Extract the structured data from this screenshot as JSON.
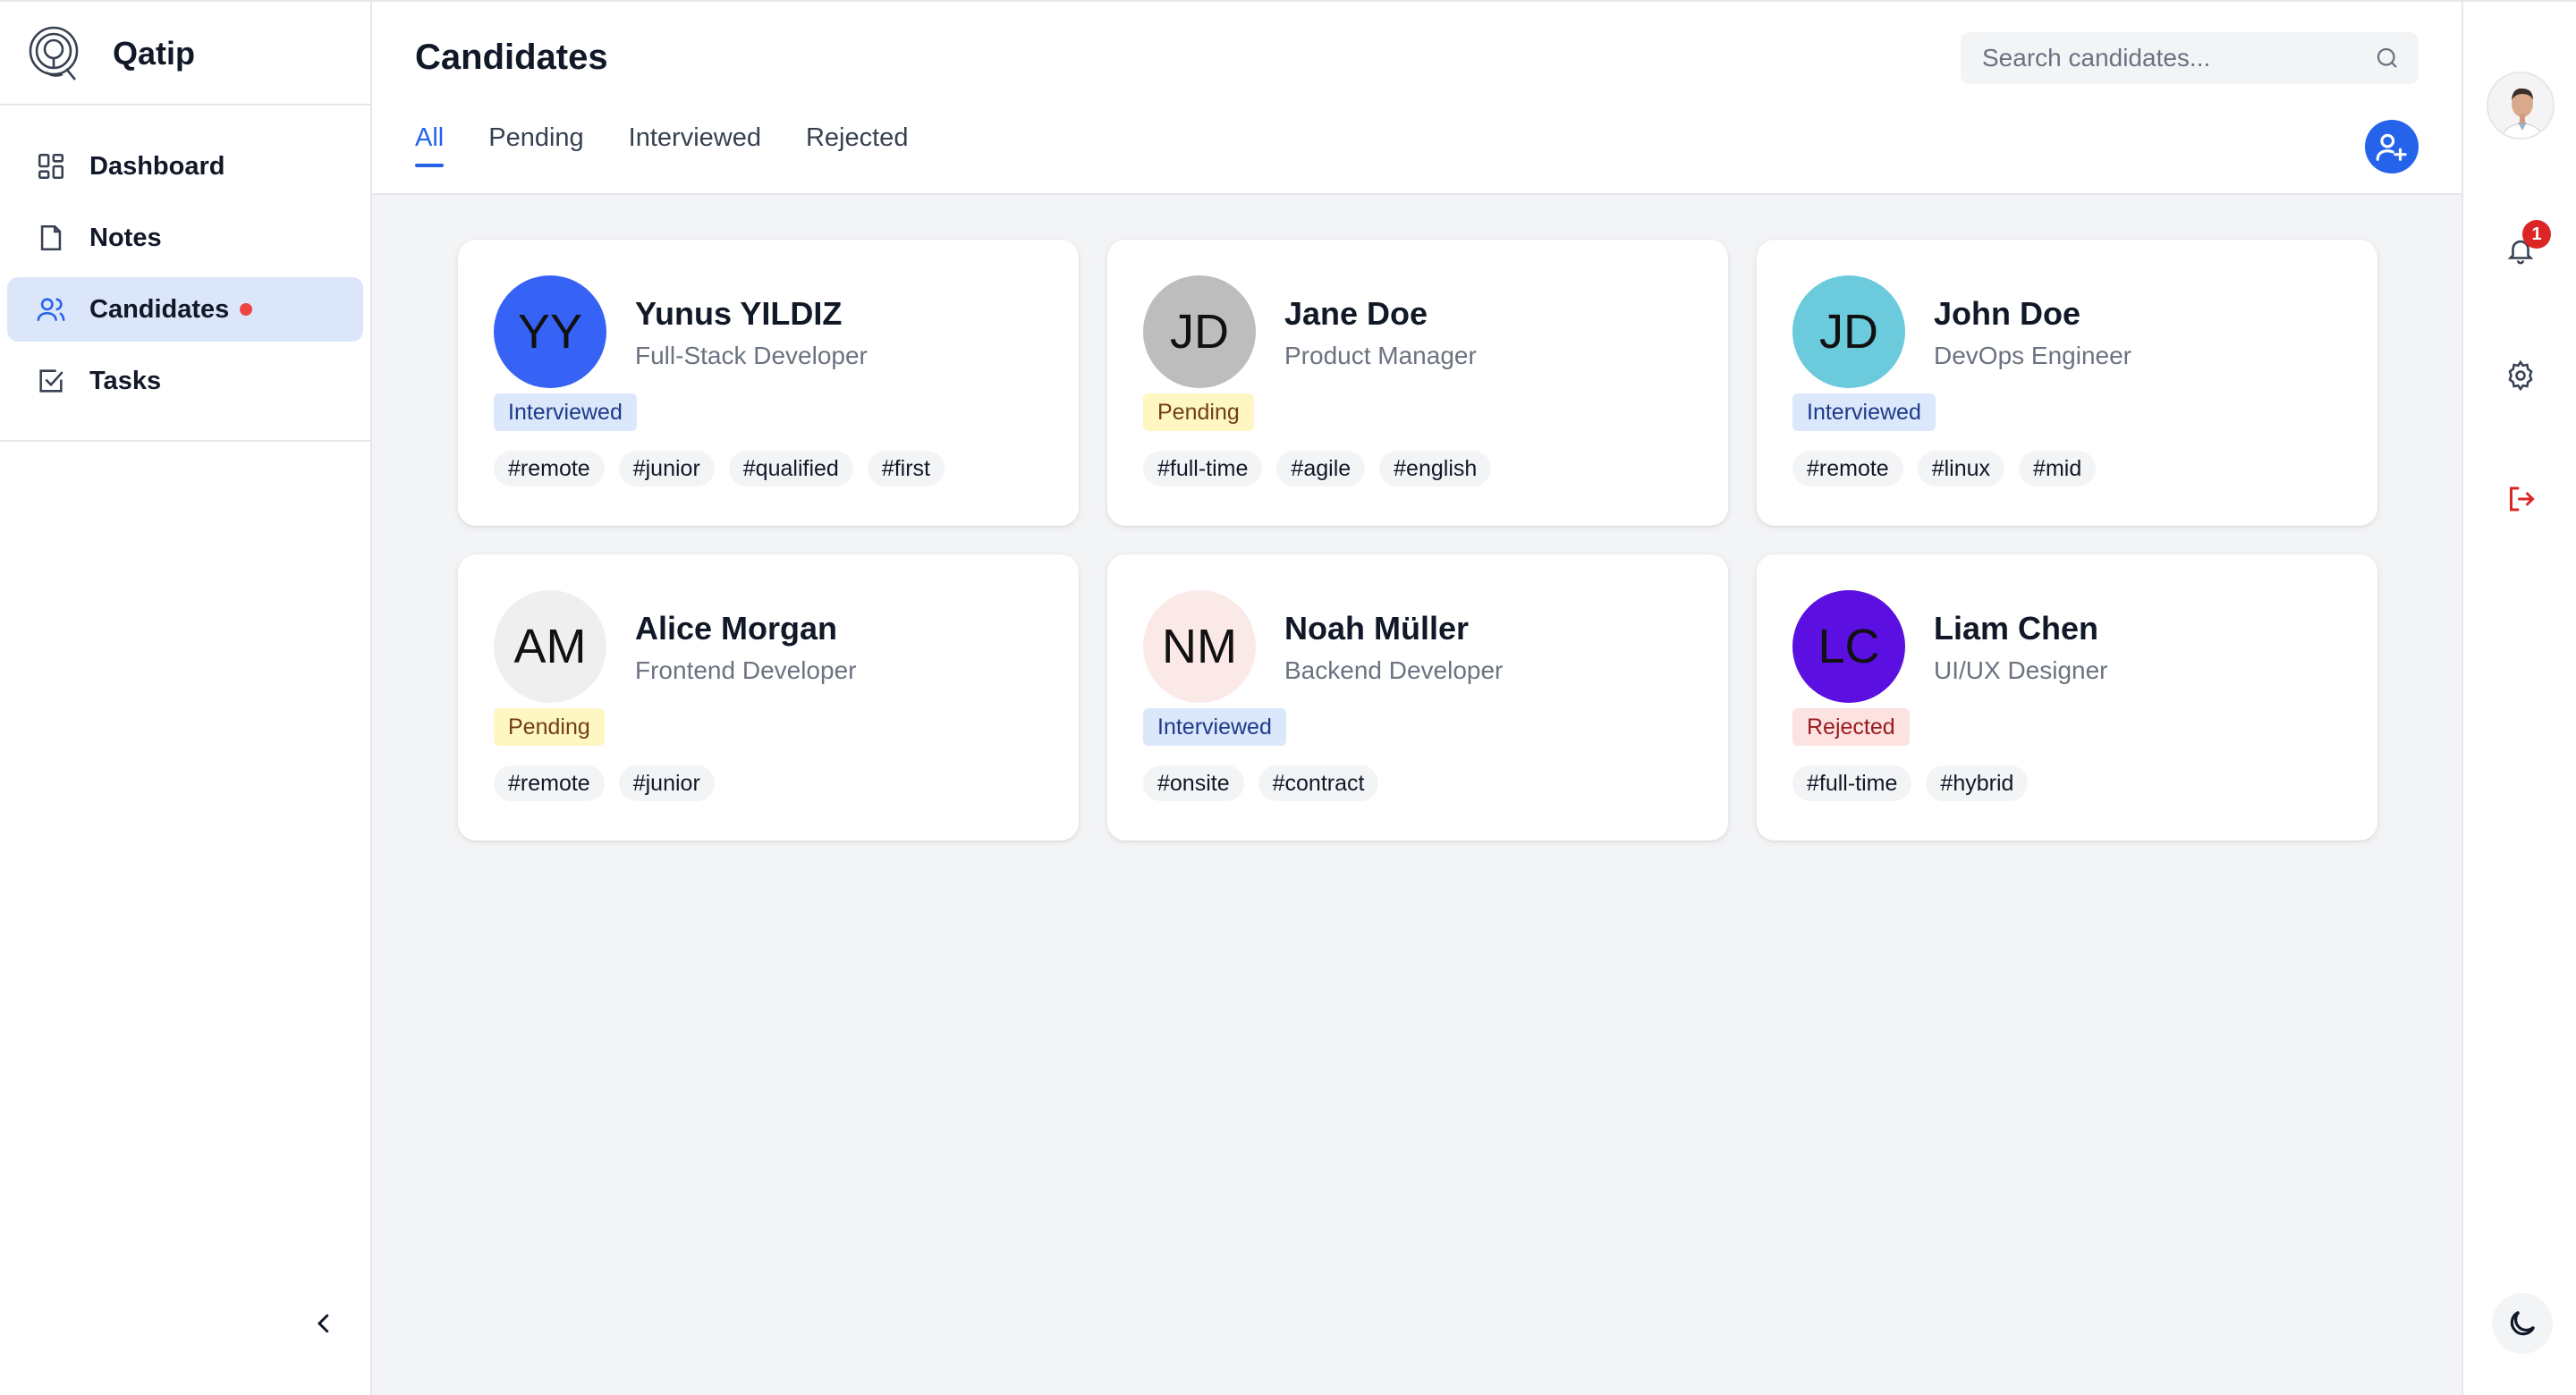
{
  "brand": {
    "name": "Qatip"
  },
  "sidebar": {
    "items": [
      {
        "label": "Dashboard",
        "icon": "dashboard-icon",
        "active": false
      },
      {
        "label": "Notes",
        "icon": "note-icon",
        "active": false
      },
      {
        "label": "Candidates",
        "icon": "users-icon",
        "active": true,
        "indicator": true
      },
      {
        "label": "Tasks",
        "icon": "checkbox-icon",
        "active": false
      }
    ],
    "collapse_icon": "chevron-left-icon"
  },
  "header": {
    "title": "Candidates",
    "search": {
      "placeholder": "Search candidates...",
      "value": ""
    },
    "tabs": [
      {
        "label": "All",
        "active": true
      },
      {
        "label": "Pending",
        "active": false
      },
      {
        "label": "Interviewed",
        "active": false
      },
      {
        "label": "Rejected",
        "active": false
      }
    ],
    "add_icon": "user-plus-icon"
  },
  "candidates": [
    {
      "initials": "YY",
      "name": "Yunus YILDIZ",
      "role": "Full-Stack Developer",
      "status": "Interviewed",
      "avatar_color": "#3663f5",
      "tags": [
        "#remote",
        "#junior",
        "#qualified",
        "#first"
      ]
    },
    {
      "initials": "JD",
      "name": "Jane Doe",
      "role": "Product Manager",
      "status": "Pending",
      "avatar_color": "#bdbdbd",
      "tags": [
        "#full-time",
        "#agile",
        "#english"
      ]
    },
    {
      "initials": "JD",
      "name": "John Doe",
      "role": "DevOps Engineer",
      "status": "Interviewed",
      "avatar_color": "#6ccadd",
      "tags": [
        "#remote",
        "#linux",
        "#mid"
      ]
    },
    {
      "initials": "AM",
      "name": "Alice Morgan",
      "role": "Frontend Developer",
      "status": "Pending",
      "avatar_color": "#efefef",
      "tags": [
        "#remote",
        "#junior"
      ]
    },
    {
      "initials": "NM",
      "name": "Noah Müller",
      "role": "Backend Developer",
      "status": "Interviewed",
      "avatar_color": "#fbe9e7",
      "tags": [
        "#onsite",
        "#contract"
      ]
    },
    {
      "initials": "LC",
      "name": "Liam Chen",
      "role": "UI/UX Designer",
      "status": "Rejected",
      "avatar_color": "#5b0fe0",
      "tags": [
        "#full-time",
        "#hybrid"
      ]
    }
  ],
  "rail": {
    "notifications_count": "1",
    "icons": [
      "profile-avatar",
      "bell-icon",
      "gear-icon",
      "logout-icon",
      "moon-icon"
    ]
  },
  "colors": {
    "accent": "#2563eb",
    "danger": "#dc2626"
  }
}
